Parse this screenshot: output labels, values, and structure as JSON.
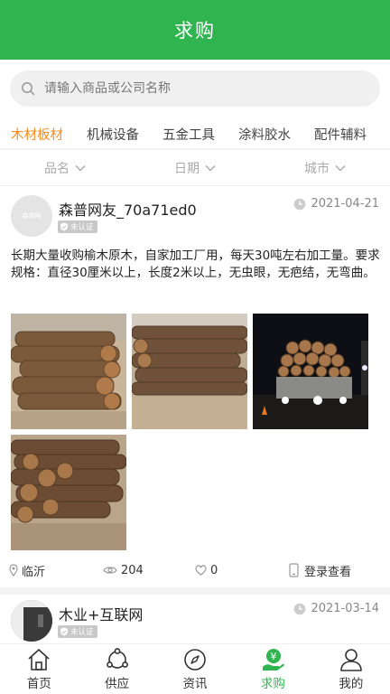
{
  "header": {
    "title": "求购"
  },
  "search": {
    "placeholder": "请输入商品或公司名称"
  },
  "tabs": [
    {
      "label": "木材板材",
      "active": true
    },
    {
      "label": "机械设备",
      "active": false
    },
    {
      "label": "五金工具",
      "active": false
    },
    {
      "label": "涂料胶水",
      "active": false
    },
    {
      "label": "配件辅料",
      "active": false
    }
  ],
  "filters": [
    {
      "label": "品名"
    },
    {
      "label": "日期"
    },
    {
      "label": "城市"
    }
  ],
  "posts": [
    {
      "username": "森普网友_70a71ed0",
      "avatar_text": "森普网",
      "badge": "未认证",
      "date": "2021-04-21",
      "description": "长期大量收购榆木原木，自家加工厂用，每天30吨左右加工量。要求规格：直径30厘米以上，长度2米以上，无虫眼，无疤结，无弯曲。",
      "location": "临沂",
      "views": "204",
      "likes": "0",
      "login_label": "登录查看",
      "photo_count": 4
    },
    {
      "username": "木业+互联网",
      "badge": "未认证",
      "date": "2021-03-14"
    }
  ],
  "tabbar": [
    {
      "label": "首页",
      "icon": "home-icon",
      "active": false
    },
    {
      "label": "供应",
      "icon": "supply-icon",
      "active": false
    },
    {
      "label": "资讯",
      "icon": "compass-icon",
      "active": false
    },
    {
      "label": "求购",
      "icon": "purchase-icon",
      "active": true
    },
    {
      "label": "我的",
      "icon": "profile-icon",
      "active": false
    }
  ],
  "colors": {
    "brand_green": "#2fb44f",
    "active_tab": "#ff8a1d",
    "badge_gray": "#c8c8c8"
  }
}
